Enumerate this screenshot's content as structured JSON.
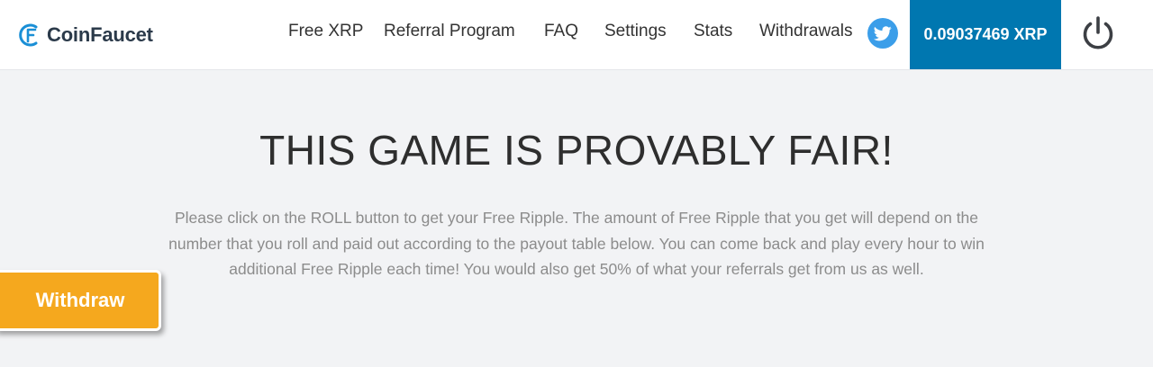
{
  "header": {
    "brand_name": "CoinFaucet",
    "nav": [
      {
        "label": "Free XRP"
      },
      {
        "label": "Referral Program"
      },
      {
        "label": "FAQ"
      },
      {
        "label": "Settings"
      },
      {
        "label": "Stats"
      },
      {
        "label": "Withdrawals"
      }
    ],
    "twitter_icon": "twitter-bird-icon",
    "balance": "0.09037469 XRP",
    "power_icon": "power-icon",
    "colors": {
      "balance_bg": "#0077b0",
      "twitter_bg": "#3b9ee9",
      "brand_accent": "#1a8fd6"
    }
  },
  "main": {
    "headline": "THIS GAME IS PROVABLY FAIR!",
    "description": "Please click on the ROLL button to get your Free Ripple. The amount of Free Ripple that you get will depend on the number that you roll and paid out according to the payout table below. You can come back and play every hour to win additional Free Ripple each time! You would also get 50% of what your referrals get from us as well."
  },
  "floating": {
    "withdraw_label": "Withdraw",
    "withdraw_color": "#f5a81e"
  }
}
